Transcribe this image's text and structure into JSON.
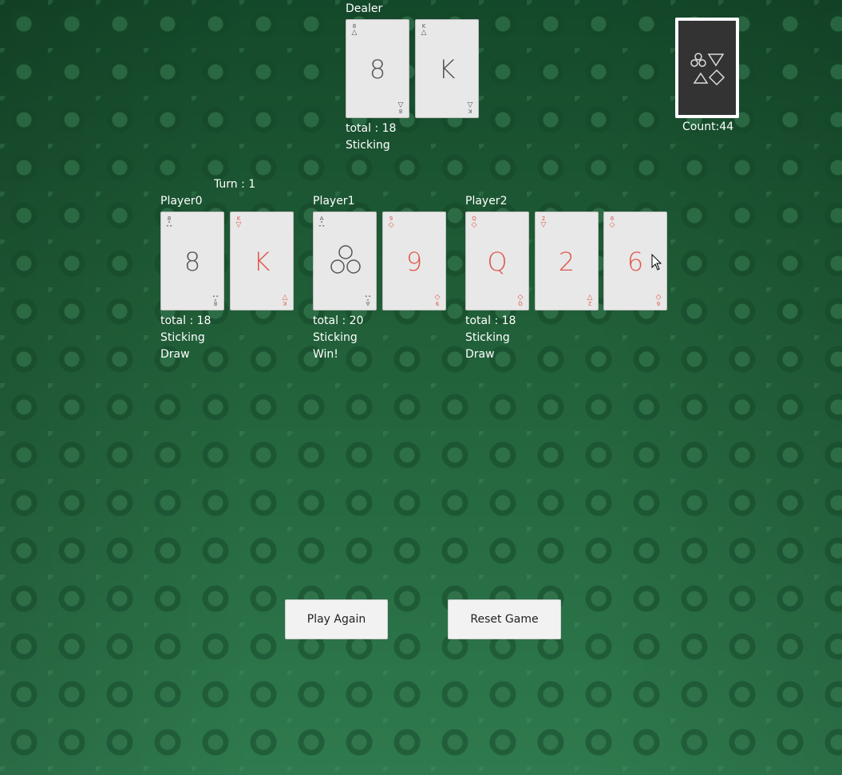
{
  "turn_label": "Turn : 1",
  "deck": {
    "count_label": "Count:44",
    "icon": "deck-back-shapes-icon"
  },
  "dealer": {
    "name": "Dealer",
    "total": "total : 18",
    "status": "Sticking",
    "cards": [
      {
        "rank": "8",
        "corner": "8",
        "suit": "triangle",
        "suit_glyph": "△",
        "color": "black"
      },
      {
        "rank": "K",
        "corner": "K",
        "suit": "triangle",
        "suit_glyph": "△",
        "color": "black"
      }
    ]
  },
  "players": [
    {
      "name": "Player0",
      "total": "total : 18",
      "status": "Sticking",
      "result": "Draw",
      "cards": [
        {
          "rank": "8",
          "corner": "8",
          "suit": "clubs",
          "suit_glyph": "ஃ",
          "color": "black"
        },
        {
          "rank": "K",
          "corner": "K",
          "suit": "down-triangle",
          "suit_glyph": "▽",
          "color": "red"
        }
      ]
    },
    {
      "name": "Player1",
      "total": "total : 20",
      "status": "Sticking",
      "result": "Win!",
      "cards": [
        {
          "rank": "A",
          "corner": "A",
          "suit": "clubs",
          "suit_glyph": "ஃ",
          "color": "black"
        },
        {
          "rank": "9",
          "corner": "9",
          "suit": "diamond",
          "suit_glyph": "◇",
          "color": "red"
        }
      ]
    },
    {
      "name": "Player2",
      "total": "total : 18",
      "status": "Sticking",
      "result": "Draw",
      "cards": [
        {
          "rank": "Q",
          "corner": "Q",
          "suit": "diamond",
          "suit_glyph": "◇",
          "color": "red"
        },
        {
          "rank": "2",
          "corner": "2",
          "suit": "down-triangle",
          "suit_glyph": "▽",
          "color": "red"
        },
        {
          "rank": "6",
          "corner": "6",
          "suit": "diamond",
          "suit_glyph": "◇",
          "color": "red"
        }
      ]
    }
  ],
  "buttons": {
    "play_again": "Play Again",
    "reset_game": "Reset Game"
  },
  "colors": {
    "table_green": "#1f5c36",
    "red_suit": "#e0584c",
    "black_suit": "#555555",
    "deck_back": "#333333"
  }
}
